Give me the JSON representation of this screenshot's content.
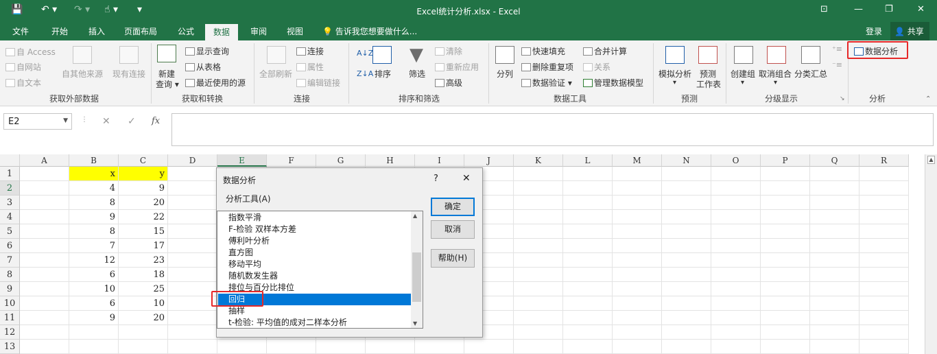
{
  "window": {
    "title": "Excel统计分析.xlsx - Excel"
  },
  "tabs": [
    "文件",
    "开始",
    "插入",
    "页面布局",
    "公式",
    "数据",
    "审阅",
    "视图"
  ],
  "active_tab": "数据",
  "tell_me": "告诉我您想要做什么...",
  "account": {
    "login": "登录",
    "share": "共享"
  },
  "ribbon": {
    "get_external": {
      "access": "自 Access",
      "web": "自网站",
      "text": "自文本",
      "other": "自其他来源",
      "existing": "现有连接",
      "label": "获取外部数据"
    },
    "transform": {
      "new_query": "新建",
      "new_query2": "查询",
      "show_queries": "显示查询",
      "from_table": "从表格",
      "recent_sources": "最近使用的源",
      "label": "获取和转换"
    },
    "connections": {
      "refresh_all": "全部刷新",
      "connections": "连接",
      "properties": "属性",
      "edit_links": "编辑链接",
      "label": "连接"
    },
    "sort_filter": {
      "sort": "排序",
      "filter": "筛选",
      "clear": "清除",
      "reapply": "重新应用",
      "advanced": "高级",
      "label": "排序和筛选"
    },
    "data_tools": {
      "text_to_columns": "分列",
      "flash_fill": "快速填充",
      "remove_duplicates": "删除重复项",
      "data_validation": "数据验证",
      "consolidate": "合并计算",
      "relationships": "关系",
      "manage_model": "管理数据模型",
      "label": "数据工具"
    },
    "forecast": {
      "what_if": "模拟分析",
      "forecast_sheet": "预测",
      "forecast_sheet2": "工作表",
      "label": "预测"
    },
    "outline": {
      "group": "创建组",
      "ungroup": "取消组合",
      "subtotal": "分类汇总",
      "label": "分级显示"
    },
    "analysis": {
      "data_analysis": "数据分析",
      "label": "分析"
    }
  },
  "formula_bar": {
    "name_box": "E2",
    "fx": "fx",
    "content": ""
  },
  "columns": [
    "A",
    "B",
    "C",
    "D",
    "E",
    "F",
    "G",
    "H",
    "I",
    "J",
    "K",
    "L",
    "M",
    "N",
    "O",
    "P",
    "Q",
    "R"
  ],
  "selected_column": "E",
  "rows": [
    "1",
    "2",
    "3",
    "4",
    "5",
    "6",
    "7",
    "8",
    "9",
    "10",
    "11",
    "12",
    "13"
  ],
  "selected_row": "2",
  "header_row": {
    "b": "x",
    "c": "y"
  },
  "data": [
    {
      "x": "4",
      "y": "9"
    },
    {
      "x": "8",
      "y": "20"
    },
    {
      "x": "9",
      "y": "22"
    },
    {
      "x": "8",
      "y": "15"
    },
    {
      "x": "7",
      "y": "17"
    },
    {
      "x": "12",
      "y": "23"
    },
    {
      "x": "6",
      "y": "18"
    },
    {
      "x": "10",
      "y": "25"
    },
    {
      "x": "6",
      "y": "10"
    },
    {
      "x": "9",
      "y": "20"
    }
  ],
  "dialog": {
    "title": "数据分析",
    "help_glyph": "?",
    "close_glyph": "✕",
    "list_label": "分析工具(A)",
    "items": [
      "指数平滑",
      "F-检验 双样本方差",
      "傅利叶分析",
      "直方图",
      "移动平均",
      "随机数发生器",
      "排位与百分比排位",
      "回归",
      "抽样",
      "t-检验: 平均值的成对二样本分析"
    ],
    "selected_item": "回归",
    "ok": "确定",
    "cancel": "取消",
    "help": "帮助(H)"
  },
  "colors": {
    "excel_green": "#217346",
    "highlight_red": "#e62828",
    "selection_blue": "#0078d7",
    "header_yellow": "#ffff00"
  }
}
